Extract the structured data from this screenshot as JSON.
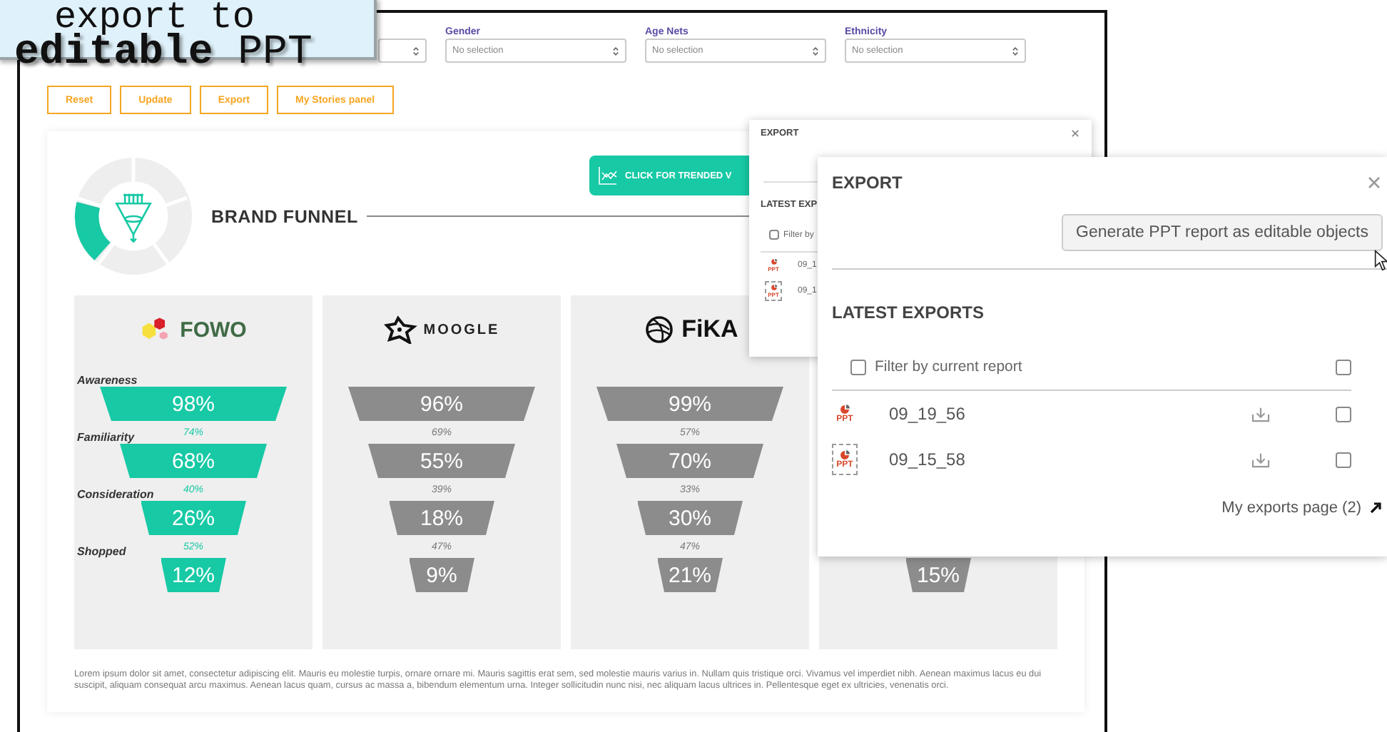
{
  "callout": {
    "lines": [
      "export to",
      "**editable** PPT"
    ]
  },
  "filters": [
    {
      "label": "Gender",
      "value": "No selection"
    },
    {
      "label": "Age Nets",
      "value": "No selection"
    },
    {
      "label": "Ethnicity",
      "value": "No selection"
    }
  ],
  "buttons": [
    "Reset",
    "Update",
    "Export",
    "My Stories panel"
  ],
  "panel": {
    "title": "BRAND FUNNEL",
    "trend_button": "CLICK FOR TRENDED V",
    "stages": [
      "Awareness",
      "Familiarity",
      "Consideration",
      "Shopped"
    ],
    "brands": [
      {
        "name": "FOWO",
        "kind": "hexagons",
        "highlighted": true,
        "stages": [
          {
            "value": "98%"
          },
          {
            "value": "68%",
            "conversion": "74%"
          },
          {
            "value": "26%",
            "conversion": "40%"
          },
          {
            "value": "12%",
            "conversion": "52%"
          }
        ]
      },
      {
        "name": "MOOGLE",
        "kind": "star",
        "highlighted": false,
        "stages": [
          {
            "value": "96%"
          },
          {
            "value": "55%",
            "conversion": "69%"
          },
          {
            "value": "18%",
            "conversion": "39%"
          },
          {
            "value": "9%",
            "conversion": "47%"
          }
        ]
      },
      {
        "name": "FiKA",
        "kind": "globe",
        "highlighted": false,
        "stages": [
          {
            "value": "99%"
          },
          {
            "value": "70%",
            "conversion": "57%"
          },
          {
            "value": "30%",
            "conversion": "33%"
          },
          {
            "value": "21%",
            "conversion": "47%"
          }
        ]
      },
      {
        "highlighted": false,
        "stages": [
          {
            "value": "15%"
          }
        ]
      }
    ],
    "footnote": "Lorem ipsum dolor sit amet, consectetur adipiscing elit. Mauris eu molestie turpis, ornare ornare mi. Mauris sagittis erat sem, sed molestie mauris varius in. Nullam quis tristique orci. Vivamus vel imperdiet nibh. Aenean maximus lacus eu dui suscipit, aliquam consequat arcu maximus. Aenean lacus quam, cursus ac massa a, bibendum elementum urna. Integer sollicitudin nunc nisi, nec aliquam lacus ultrices in. Pellentesque eget ex ultricies, venenatis orci."
  },
  "export_popup_back": {
    "title": "EXPORT",
    "section": "LATEST EXP",
    "filter": {
      "label": "Filter by",
      "checked": false
    },
    "rows": [
      {
        "name": "09_1",
        "kind": "ppt",
        "type": "PPT"
      },
      {
        "name": "09_1",
        "kind": "ppt-pending",
        "type": "PPT"
      }
    ]
  },
  "export_popup": {
    "title": "EXPORT",
    "generate_button": "Generate PPT report as editable objects",
    "section": "LATEST EXPORTS",
    "filter": {
      "label": "Filter by current report",
      "checked": false
    },
    "select_all": {
      "checked": false
    },
    "rows": [
      {
        "name": "09_19_56",
        "kind": "ppt",
        "type": "PPT",
        "checked": false
      },
      {
        "name": "09_15_58",
        "kind": "ppt-pending",
        "type": "PPT",
        "checked": false
      }
    ],
    "footer_link": "My exports page (2)"
  }
}
